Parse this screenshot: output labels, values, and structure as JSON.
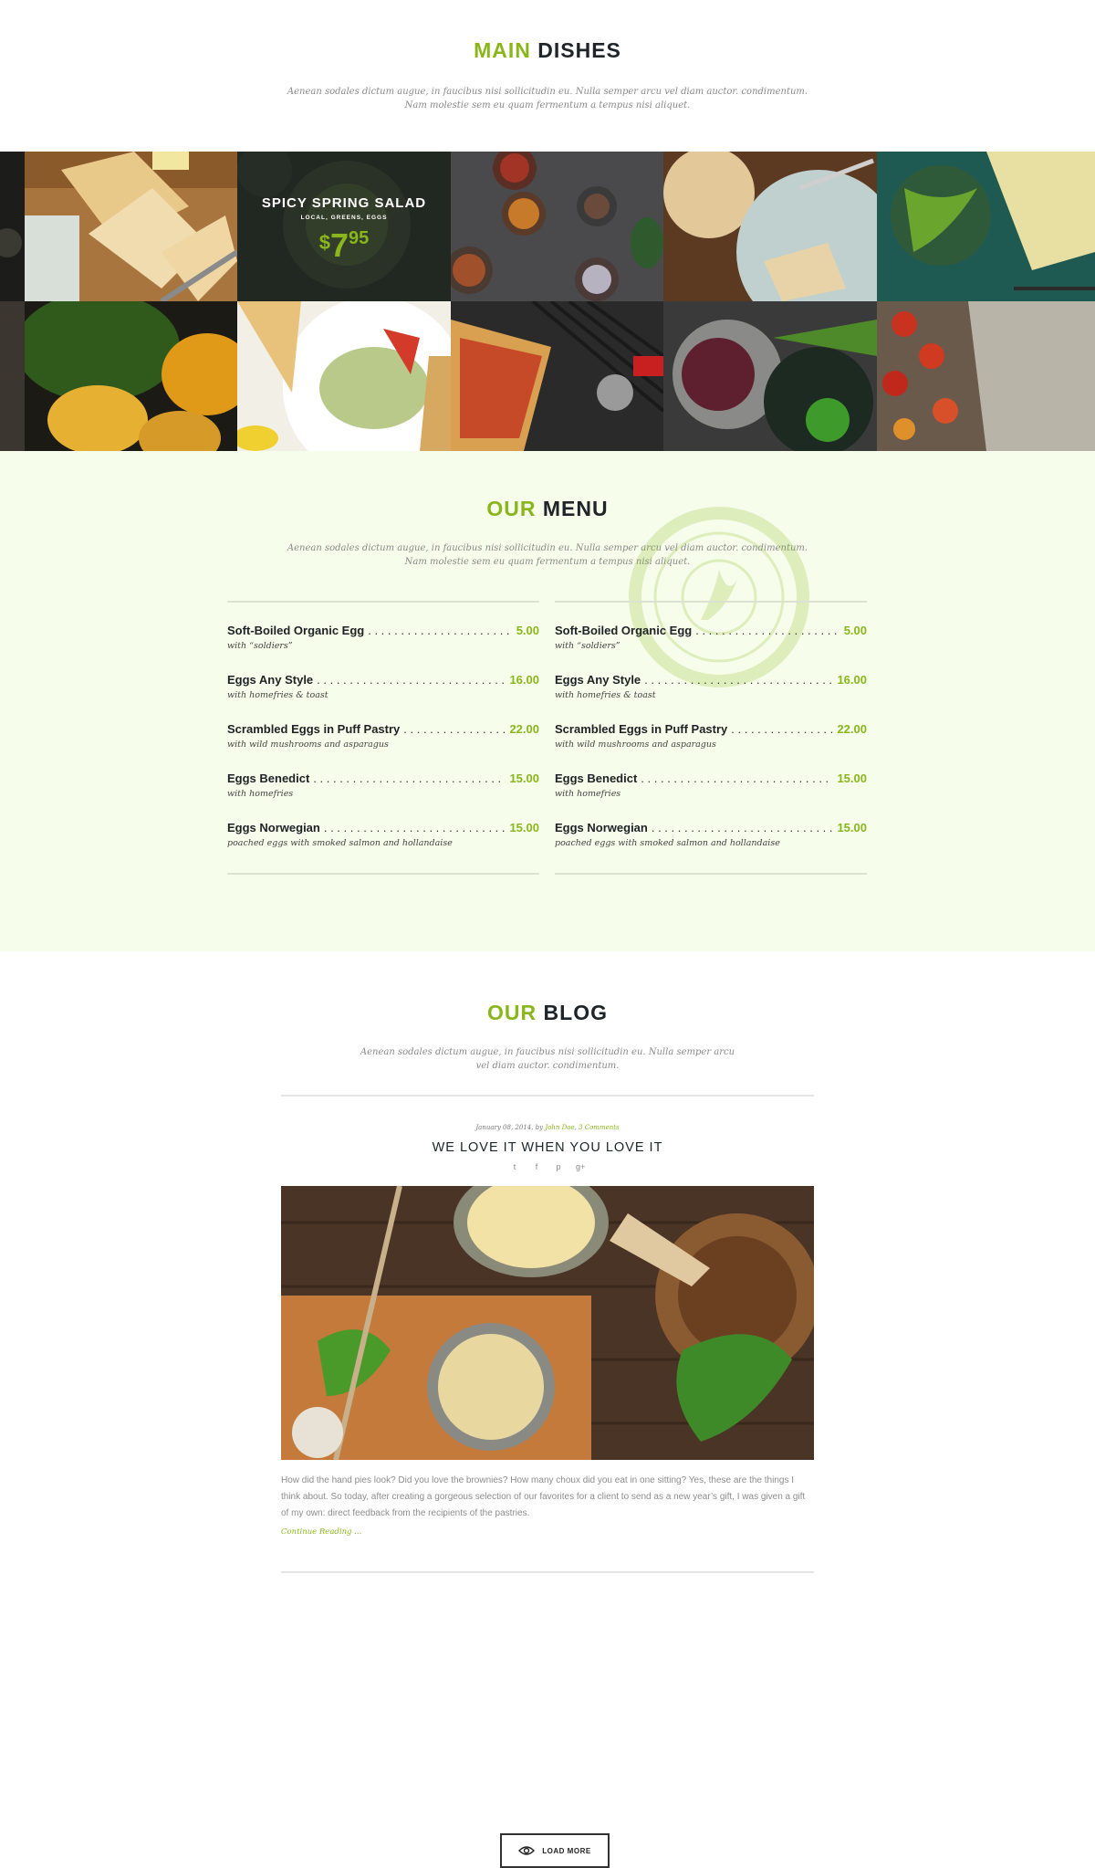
{
  "main_dishes": {
    "title_accent": "MAIN",
    "title_rest": "DISHES",
    "desc_line1": "Aenean sodales dictum augue, in faucibus nisi sollicitudin eu. Nulla semper arcu vel diam auctor. condimentum.",
    "desc_line2": "Nam molestie sem eu quam fermentum a tempus nisi aliquet."
  },
  "promo": {
    "title": "SPICY SPRING SALAD",
    "subtitle": "LOCAL, GREENS, EGGS",
    "currency": "$",
    "price_main": "7",
    "price_cents": "95"
  },
  "menu": {
    "title_accent": "OUR",
    "title_rest": "MENU",
    "desc_line1": "Aenean sodales dictum augue, in faucibus nisi sollicitudin eu. Nulla semper arcu vel diam auctor. condimentum.",
    "desc_line2": "Nam molestie sem eu quam fermentum a tempus nisi aliquet.",
    "left": [
      {
        "name": "Soft-Boiled Organic Egg",
        "price": "5.00",
        "desc": "with “soldiers”"
      },
      {
        "name": "Eggs Any Style",
        "price": "16.00",
        "desc": "with homefries & toast"
      },
      {
        "name": "Scrambled Eggs in Puff Pastry",
        "price": "22.00",
        "desc": "with wild mushrooms and asparagus"
      },
      {
        "name": "Eggs Benedict",
        "price": "15.00",
        "desc": "with homefries"
      },
      {
        "name": "Eggs Norwegian",
        "price": "15.00",
        "desc": "poached eggs with smoked salmon and hollandaise"
      }
    ],
    "right": [
      {
        "name": "Soft-Boiled Organic Egg",
        "price": "5.00",
        "desc": "with “soldiers”"
      },
      {
        "name": "Eggs Any Style",
        "price": "16.00",
        "desc": "with homefries & toast"
      },
      {
        "name": "Scrambled Eggs in Puff Pastry",
        "price": "22.00",
        "desc": "with wild mushrooms and asparagus"
      },
      {
        "name": "Eggs Benedict",
        "price": "15.00",
        "desc": "with homefries"
      },
      {
        "name": "Eggs Norwegian",
        "price": "15.00",
        "desc": "poached eggs with smoked salmon and hollandaise"
      }
    ]
  },
  "blog": {
    "title_accent": "OUR",
    "title_rest": "BLOG",
    "desc_line1": "Aenean sodales dictum augue, in faucibus nisi sollicitudin eu. Nulla semper arcu",
    "desc_line2": "vel diam auctor. condimentum.",
    "post": {
      "date": "January 08, 2014, by",
      "author": "John Doe",
      "comments": "3 Comments",
      "title": "WE LOVE IT WHEN YOU LOVE IT",
      "share_icons": [
        "twitter-icon",
        "facebook-icon",
        "pinterest-icon",
        "google-plus-icon"
      ],
      "excerpt": "How did the hand pies look?  Did you love the brownies?  How many choux did you eat in one sitting?  Yes, these are the things I think about.  So today, after creating a gorgeous selection of our favorites for a client to send as a new year’s gift, I was given a gift of my own: direct feedback from the recipients of the pastries.",
      "read_more": "Continue Reading ..."
    },
    "load_more": "LOAD MORE"
  },
  "colors": {
    "accent": "#8ab61c",
    "dark": "#1f2428",
    "menu_bg": "#f6fdea"
  }
}
